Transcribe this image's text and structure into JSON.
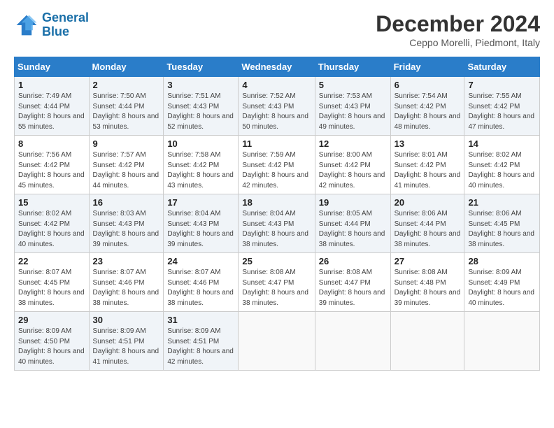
{
  "header": {
    "logo_line1": "General",
    "logo_line2": "Blue",
    "month_title": "December 2024",
    "subtitle": "Ceppo Morelli, Piedmont, Italy"
  },
  "weekdays": [
    "Sunday",
    "Monday",
    "Tuesday",
    "Wednesday",
    "Thursday",
    "Friday",
    "Saturday"
  ],
  "weeks": [
    [
      {
        "day": "1",
        "sunrise": "7:49 AM",
        "sunset": "4:44 PM",
        "daylight": "8 hours and 55 minutes."
      },
      {
        "day": "2",
        "sunrise": "7:50 AM",
        "sunset": "4:44 PM",
        "daylight": "8 hours and 53 minutes."
      },
      {
        "day": "3",
        "sunrise": "7:51 AM",
        "sunset": "4:43 PM",
        "daylight": "8 hours and 52 minutes."
      },
      {
        "day": "4",
        "sunrise": "7:52 AM",
        "sunset": "4:43 PM",
        "daylight": "8 hours and 50 minutes."
      },
      {
        "day": "5",
        "sunrise": "7:53 AM",
        "sunset": "4:43 PM",
        "daylight": "8 hours and 49 minutes."
      },
      {
        "day": "6",
        "sunrise": "7:54 AM",
        "sunset": "4:42 PM",
        "daylight": "8 hours and 48 minutes."
      },
      {
        "day": "7",
        "sunrise": "7:55 AM",
        "sunset": "4:42 PM",
        "daylight": "8 hours and 47 minutes."
      }
    ],
    [
      {
        "day": "8",
        "sunrise": "7:56 AM",
        "sunset": "4:42 PM",
        "daylight": "8 hours and 45 minutes."
      },
      {
        "day": "9",
        "sunrise": "7:57 AM",
        "sunset": "4:42 PM",
        "daylight": "8 hours and 44 minutes."
      },
      {
        "day": "10",
        "sunrise": "7:58 AM",
        "sunset": "4:42 PM",
        "daylight": "8 hours and 43 minutes."
      },
      {
        "day": "11",
        "sunrise": "7:59 AM",
        "sunset": "4:42 PM",
        "daylight": "8 hours and 42 minutes."
      },
      {
        "day": "12",
        "sunrise": "8:00 AM",
        "sunset": "4:42 PM",
        "daylight": "8 hours and 42 minutes."
      },
      {
        "day": "13",
        "sunrise": "8:01 AM",
        "sunset": "4:42 PM",
        "daylight": "8 hours and 41 minutes."
      },
      {
        "day": "14",
        "sunrise": "8:02 AM",
        "sunset": "4:42 PM",
        "daylight": "8 hours and 40 minutes."
      }
    ],
    [
      {
        "day": "15",
        "sunrise": "8:02 AM",
        "sunset": "4:42 PM",
        "daylight": "8 hours and 40 minutes."
      },
      {
        "day": "16",
        "sunrise": "8:03 AM",
        "sunset": "4:43 PM",
        "daylight": "8 hours and 39 minutes."
      },
      {
        "day": "17",
        "sunrise": "8:04 AM",
        "sunset": "4:43 PM",
        "daylight": "8 hours and 39 minutes."
      },
      {
        "day": "18",
        "sunrise": "8:04 AM",
        "sunset": "4:43 PM",
        "daylight": "8 hours and 38 minutes."
      },
      {
        "day": "19",
        "sunrise": "8:05 AM",
        "sunset": "4:44 PM",
        "daylight": "8 hours and 38 minutes."
      },
      {
        "day": "20",
        "sunrise": "8:06 AM",
        "sunset": "4:44 PM",
        "daylight": "8 hours and 38 minutes."
      },
      {
        "day": "21",
        "sunrise": "8:06 AM",
        "sunset": "4:45 PM",
        "daylight": "8 hours and 38 minutes."
      }
    ],
    [
      {
        "day": "22",
        "sunrise": "8:07 AM",
        "sunset": "4:45 PM",
        "daylight": "8 hours and 38 minutes."
      },
      {
        "day": "23",
        "sunrise": "8:07 AM",
        "sunset": "4:46 PM",
        "daylight": "8 hours and 38 minutes."
      },
      {
        "day": "24",
        "sunrise": "8:07 AM",
        "sunset": "4:46 PM",
        "daylight": "8 hours and 38 minutes."
      },
      {
        "day": "25",
        "sunrise": "8:08 AM",
        "sunset": "4:47 PM",
        "daylight": "8 hours and 38 minutes."
      },
      {
        "day": "26",
        "sunrise": "8:08 AM",
        "sunset": "4:47 PM",
        "daylight": "8 hours and 39 minutes."
      },
      {
        "day": "27",
        "sunrise": "8:08 AM",
        "sunset": "4:48 PM",
        "daylight": "8 hours and 39 minutes."
      },
      {
        "day": "28",
        "sunrise": "8:09 AM",
        "sunset": "4:49 PM",
        "daylight": "8 hours and 40 minutes."
      }
    ],
    [
      {
        "day": "29",
        "sunrise": "8:09 AM",
        "sunset": "4:50 PM",
        "daylight": "8 hours and 40 minutes."
      },
      {
        "day": "30",
        "sunrise": "8:09 AM",
        "sunset": "4:51 PM",
        "daylight": "8 hours and 41 minutes."
      },
      {
        "day": "31",
        "sunrise": "8:09 AM",
        "sunset": "4:51 PM",
        "daylight": "8 hours and 42 minutes."
      },
      null,
      null,
      null,
      null
    ]
  ]
}
